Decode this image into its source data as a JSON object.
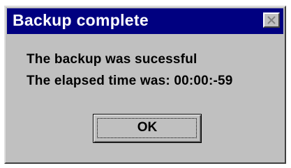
{
  "dialog": {
    "title": "Backup complete",
    "close_icon": "close-icon",
    "messages": [
      "The backup was sucessful",
      "The elapsed time was: 00:00:-59"
    ],
    "ok_label": "OK"
  },
  "colors": {
    "titlebar": "#000080",
    "face": "#c0c0c0",
    "title_text": "#ffffff"
  }
}
